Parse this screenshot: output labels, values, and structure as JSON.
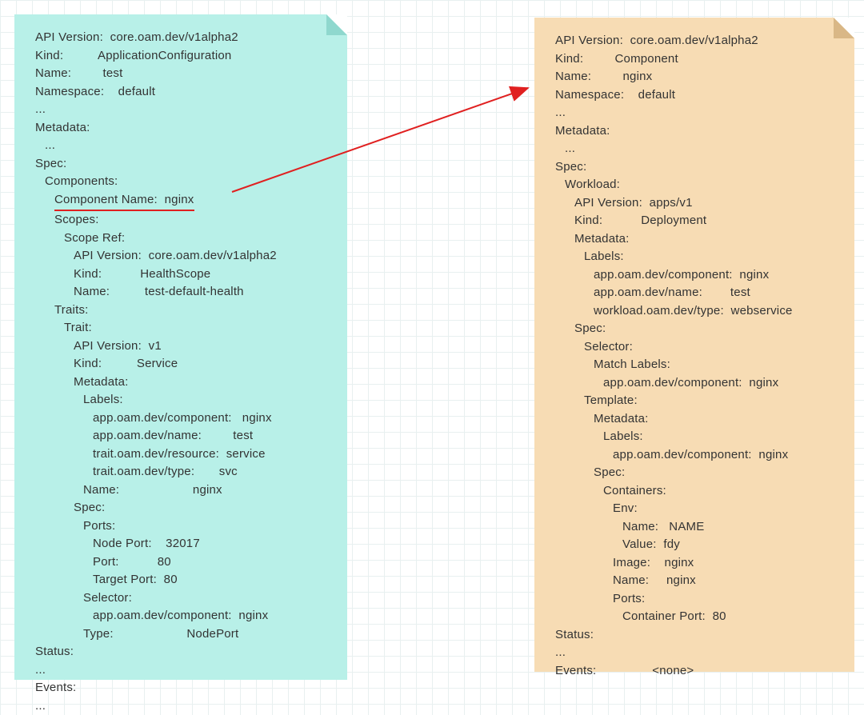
{
  "left": {
    "apiVersionLabel": "API Version:  core.oam.dev/v1alpha2",
    "kindLabel": "Kind:          ApplicationConfiguration",
    "nameLabel": "Name:         test",
    "namespaceLabel": "Namespace:    default",
    "ellipsis1": "...",
    "metadataLabel": "Metadata:",
    "ellipsis2": "...",
    "specLabel": "Spec:",
    "componentsLabel": "Components:",
    "componentNameLabel": "Component Name:  nginx",
    "scopesLabel": "Scopes:",
    "scopeRefLabel": "Scope Ref:",
    "scopeApiVersion": "API Version:  core.oam.dev/v1alpha2",
    "scopeKind": "Kind:           HealthScope",
    "scopeName": "Name:          test-default-health",
    "traitsLabel": "Traits:",
    "traitLabel": "Trait:",
    "traitApiVersion": "API Version:  v1",
    "traitKind": "Kind:          Service",
    "traitMetadata": "Metadata:",
    "traitLabels": "Labels:",
    "labelComponent": "app.oam.dev/component:   nginx",
    "labelName": "app.oam.dev/name:         test",
    "labelResource": "trait.oam.dev/resource:  service",
    "labelType": "trait.oam.dev/type:       svc",
    "traitName": "Name:                     nginx",
    "traitSpec": "Spec:",
    "portsLabel": "Ports:",
    "nodePort": "Node Port:    32017",
    "port": "Port:           80",
    "targetPort": "Target Port:  80",
    "selectorLabel": "Selector:",
    "selectorComponent": "app.oam.dev/component:  nginx",
    "typeLabel": "Type:                     NodePort",
    "statusLabel": "Status:",
    "ellipsis3": "...",
    "eventsLabel": "Events:",
    "ellipsis4": "..."
  },
  "right": {
    "apiVersionLabel": "API Version:  core.oam.dev/v1alpha2",
    "kindLabel": "Kind:         Component",
    "nameLabel": "Name:         nginx",
    "namespaceLabel": "Namespace:    default",
    "ellipsis1": "...",
    "metadataLabel": "Metadata:",
    "ellipsis2": "...",
    "specLabel": "Spec:",
    "workloadLabel": "Workload:",
    "wlApiVersion": "API Version:  apps/v1",
    "wlKind": "Kind:           Deployment",
    "wlMetadata": "Metadata:",
    "wlLabels": "Labels:",
    "labelComponent": "app.oam.dev/component:  nginx",
    "labelName": "app.oam.dev/name:        test",
    "labelWorkloadType": "workload.oam.dev/type:  webservice",
    "wlSpec": "Spec:",
    "selectorLabel": "Selector:",
    "matchLabels": "Match Labels:",
    "matchComponent": "app.oam.dev/component:  nginx",
    "templateLabel": "Template:",
    "tMetadata": "Metadata:",
    "tLabels": "Labels:",
    "tLabelComponent": "app.oam.dev/component:  nginx",
    "tSpec": "Spec:",
    "containersLabel": "Containers:",
    "envLabel": "Env:",
    "envName": "Name:   NAME",
    "envValue": "Value:  fdy",
    "imageLabel": "Image:    nginx",
    "cNameLabel": "Name:     nginx",
    "portsLabel": "Ports:",
    "containerPort": "Container Port:  80",
    "statusLabel": "Status:",
    "ellipsis3": "...",
    "eventsLabel": "Events:                <none>"
  }
}
